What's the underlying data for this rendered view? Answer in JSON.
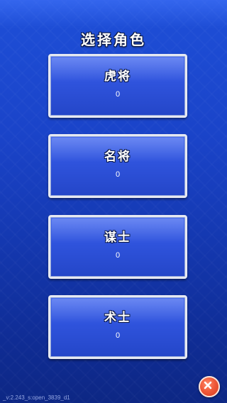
{
  "title": "选择角色",
  "roles": [
    {
      "name": "虎将",
      "value": "0"
    },
    {
      "name": "名将",
      "value": "0"
    },
    {
      "name": "谋士",
      "value": "0"
    },
    {
      "name": "术士",
      "value": "0"
    }
  ],
  "version": "_v:2.243_s:open_3839_d1",
  "close_icon": "close-icon",
  "colors": {
    "background": "#1a43c8",
    "card": "#2f53dc",
    "card_border": "#e6e9f2",
    "close": "#f05a3a"
  }
}
